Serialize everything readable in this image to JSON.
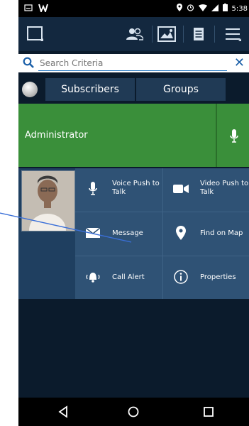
{
  "status_bar": {
    "time": "5:38",
    "left_icons": [
      "notification-icon",
      "app-w-icon"
    ],
    "right_icons": [
      "location-icon",
      "alarm-icon",
      "wifi-icon",
      "signal-icon",
      "battery-icon"
    ]
  },
  "toolbar": {
    "buttons": [
      "select-icon",
      "group-users-icon",
      "map-image-icon",
      "list-icon",
      "menu-icon"
    ]
  },
  "search": {
    "placeholder": "Search Criteria",
    "clear_symbol": "✕"
  },
  "tabs": {
    "subscribers": "Subscribers",
    "groups": "Groups"
  },
  "admin_row": {
    "label": "Administrator"
  },
  "context_menu": {
    "items": [
      {
        "label": "Voice Push to Talk",
        "icon": "microphone-icon"
      },
      {
        "label": "Video Push to Talk",
        "icon": "video-camera-icon"
      },
      {
        "label": "Message",
        "icon": "envelope-icon"
      },
      {
        "label": "Find on Map",
        "icon": "map-pin-icon"
      },
      {
        "label": "Call Alert",
        "icon": "bell-icon"
      },
      {
        "label": "Properties",
        "icon": "info-icon"
      }
    ]
  },
  "navbar": {
    "buttons": [
      "back-icon",
      "home-icon",
      "recents-icon"
    ]
  },
  "colors": {
    "background": "#0b1b2c",
    "toolbar": "#13283f",
    "admin_green": "#3a8f3a",
    "menu_bg": "#2f5275",
    "accent_blue": "#1a5fa8"
  }
}
